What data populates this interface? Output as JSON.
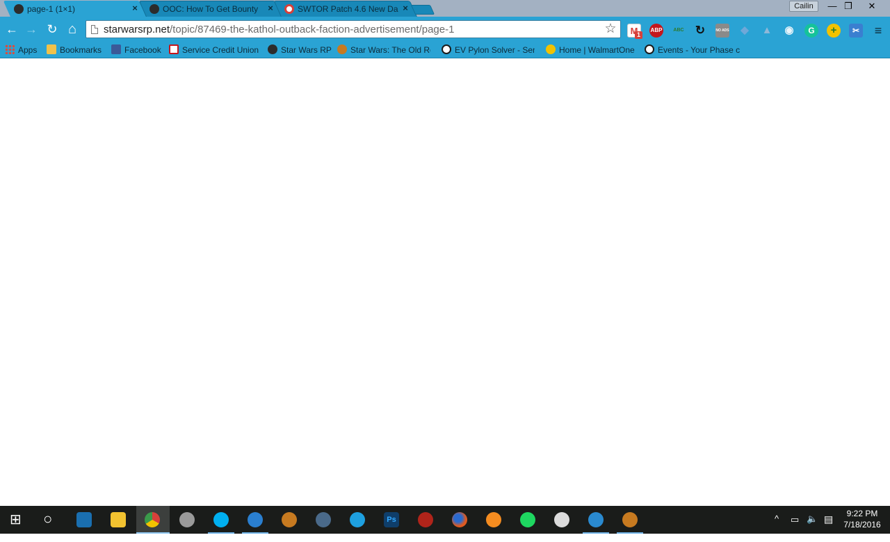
{
  "tabs": [
    {
      "title": "page-1 (1×1)",
      "active": true,
      "favicon": "swrp-icon"
    },
    {
      "title": "OOC: How To Get Bounty",
      "active": false,
      "favicon": "swrp-icon"
    },
    {
      "title": "SWTOR Patch 4.6 New Da",
      "active": false,
      "favicon": "swtor-news-icon"
    }
  ],
  "tab_close_glyph": "×",
  "profile_name": "Cailin",
  "window_controls": {
    "minimize": "—",
    "maximize": "❐",
    "close": "✕"
  },
  "toolbar": {
    "back": "←",
    "forward": "→",
    "reload": "↻",
    "home": "⌂"
  },
  "omnibox": {
    "host": "starwarsrp.net",
    "path": "/topic/87469-the-kathol-outback-faction-advertisement/page-1",
    "star": "☆"
  },
  "extensions": [
    {
      "name": "gmail-checker-icon",
      "label": "M",
      "badge": "1",
      "color": "#d7403a"
    },
    {
      "name": "adblock-plus-icon",
      "label": "ABP",
      "color": "#c4161c"
    },
    {
      "name": "spellcheck-icon",
      "label": "ABC",
      "color": "#3a9a3a"
    },
    {
      "name": "sync-icon",
      "label": "↻",
      "color": "#1a1a1a"
    },
    {
      "name": "no-ads-icon",
      "label": "NO ADS",
      "color": "#8a8a8a"
    },
    {
      "name": "dropbox-icon",
      "label": "◆",
      "color": "#7fb0d6"
    },
    {
      "name": "drive-icon",
      "label": "▲",
      "color": "#8fb8d8"
    },
    {
      "name": "eye-icon",
      "label": "◉",
      "color": "#d9e8f0"
    },
    {
      "name": "grammarly-icon",
      "label": "G",
      "color": "#15c39a"
    },
    {
      "name": "plus-extension-icon",
      "label": "+",
      "color": "#f2c200"
    },
    {
      "name": "screenshot-icon",
      "label": "✂",
      "color": "#3a7fd0"
    }
  ],
  "menu_glyph": "≡",
  "bookmarks": [
    {
      "label": "Apps",
      "icon": "apps-grid-icon"
    },
    {
      "label": "Bookmarks",
      "icon": "folder-icon"
    },
    {
      "label": "Facebook",
      "icon": "facebook-icon"
    },
    {
      "label": "Service Credit Union",
      "icon": "credit-union-icon"
    },
    {
      "label": "Star Wars RP",
      "icon": "swrp-icon"
    },
    {
      "label": "Star Wars: The Old Re",
      "icon": "swtor-icon"
    },
    {
      "label": "EV Pylon Solver - Sen",
      "icon": "ev-icon"
    },
    {
      "label": "Home | WalmartOne",
      "icon": "walmart-icon"
    },
    {
      "label": "Events - Your Phase c",
      "icon": "ev-icon"
    }
  ],
  "taskbar": {
    "items": [
      {
        "name": "cortana-search-icon",
        "color": "#1a1c1a"
      },
      {
        "name": "task-view-icon",
        "color": "#1a6fb0"
      },
      {
        "name": "file-explorer-icon",
        "color": "#f2c230"
      },
      {
        "name": "chrome-icon",
        "color": "#3a9a4a"
      },
      {
        "name": "webcam-icon",
        "color": "#9a9a9a"
      },
      {
        "name": "skype-icon",
        "color": "#00aff0"
      },
      {
        "name": "thunderbird-icon",
        "color": "#2a7fd0"
      },
      {
        "name": "swtor-launcher-icon",
        "color": "#c77a20"
      },
      {
        "name": "ts-icon",
        "color": "#4a6a8a"
      },
      {
        "name": "internet-explorer-icon",
        "color": "#1ea0e0"
      },
      {
        "name": "photoshop-icon",
        "color": "#0f3e6a"
      },
      {
        "name": "game-icon",
        "color": "#b0241a"
      },
      {
        "name": "firefox-icon",
        "color": "#e05a20"
      },
      {
        "name": "google-play-music-icon",
        "color": "#f58c20"
      },
      {
        "name": "spotify-icon",
        "color": "#1ed760"
      },
      {
        "name": "steam-tool-icon",
        "color": "#dcdcdc"
      },
      {
        "name": "uplay-icon",
        "color": "#2a8ad0"
      },
      {
        "name": "swtor-game-icon",
        "color": "#c77a20"
      }
    ],
    "start_glyph": "⊞",
    "cortana_glyph": "○",
    "tray": {
      "chevron": "^",
      "network": "▭",
      "volume": "🔈",
      "notifications": "▤"
    },
    "time": "9:22 PM",
    "date": "7/18/2016"
  }
}
